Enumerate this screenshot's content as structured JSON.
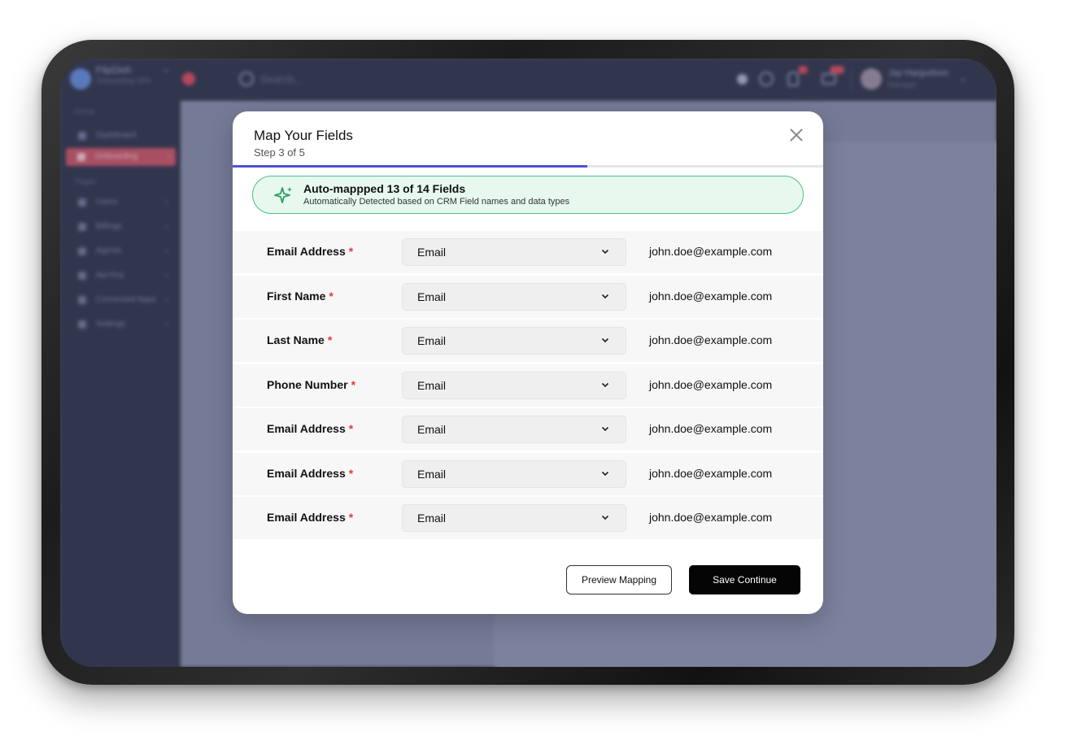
{
  "background_app": {
    "brand": {
      "name": "FlipDish",
      "subtitle": "Onboarding 33%"
    },
    "search": {
      "placeholder": "Search..."
    },
    "user": {
      "name": "Jay Hargudson",
      "role": "Manager"
    },
    "sidebar": {
      "section_home": "Home",
      "section_pages": "Pages",
      "items": [
        {
          "label": "Dashboard"
        },
        {
          "label": "Onboarding"
        },
        {
          "label": "Users"
        },
        {
          "label": "Billings"
        },
        {
          "label": "Agents"
        },
        {
          "label": "Api Key"
        },
        {
          "label": "Connected Apps"
        },
        {
          "label": "Settings"
        }
      ]
    }
  },
  "modal": {
    "title": "Map Your Fields",
    "step": "Step 3 of 5",
    "progress_fraction": 0.6,
    "banner": {
      "icon": "sparkle-icon",
      "title": "Auto-mappped 13 of 14 Fields",
      "subtitle": "Automatically Detected based on CRM Field names and data types",
      "colors": {
        "background": "#e7f8ef",
        "border": "#4ebf86",
        "icon": "#2e9d63"
      }
    },
    "rows": [
      {
        "label": "Email Address",
        "required": "*",
        "selected": "Email",
        "sample": "john.doe@example.com"
      },
      {
        "label": "First Name",
        "required": "*",
        "selected": "Email",
        "sample": "john.doe@example.com"
      },
      {
        "label": "Last Name",
        "required": "*",
        "selected": "Email",
        "sample": "john.doe@example.com"
      },
      {
        "label": "Phone Number",
        "required": "*",
        "selected": "Email",
        "sample": "john.doe@example.com"
      },
      {
        "label": "Email Address",
        "required": "*",
        "selected": "Email",
        "sample": "john.doe@example.com"
      },
      {
        "label": "Email Address",
        "required": "*",
        "selected": "Email",
        "sample": "john.doe@example.com"
      },
      {
        "label": "Email Address",
        "required": "*",
        "selected": "Email",
        "sample": "john.doe@example.com"
      }
    ],
    "buttons": {
      "preview_label": "Preview Mapping",
      "save_label": "Save Continue"
    },
    "colors": {
      "accent": "#4f52d6",
      "required": "#e03a3a"
    }
  }
}
